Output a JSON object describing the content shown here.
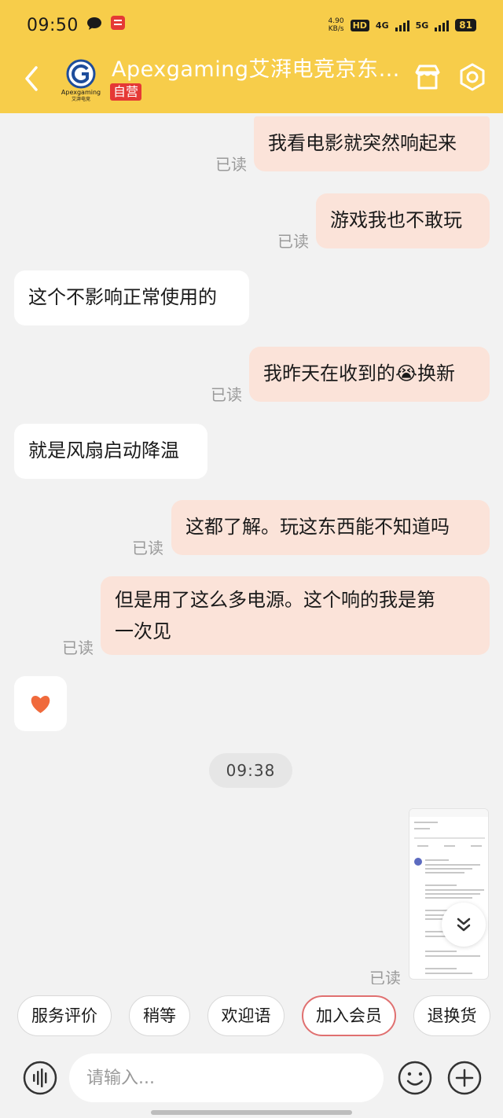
{
  "status_bar": {
    "time": "09:50",
    "net_speed_value": "4.90",
    "net_speed_unit": "KB/s",
    "hd_label": "HD",
    "sig1_label": "4G",
    "sig2_label": "5G",
    "battery": "81"
  },
  "header": {
    "shop_name": "Apexgaming艾湃电竞京东…",
    "self_tag": "自营",
    "logo_text": "Apexgaming",
    "logo_sub": "艾湃电竞"
  },
  "messages": [
    {
      "direction": "out",
      "text": "我看电影就突然响起来",
      "read": "已读"
    },
    {
      "direction": "out",
      "text": "游戏我也不敢玩",
      "read": "已读"
    },
    {
      "direction": "in",
      "text": "这个不影响正常使用的"
    },
    {
      "direction": "out",
      "text_before": "我昨天在收到的",
      "emoji": "😭",
      "text_after": "换新",
      "read": "已读"
    },
    {
      "direction": "in",
      "text": "就是风扇启动降温"
    },
    {
      "direction": "out",
      "text": "这都了解。玩这东西能不知道吗",
      "read": "已读"
    },
    {
      "direction": "out",
      "line1": "但是用了这么多电源。这个响的我是第",
      "line2": "一次见",
      "read": "已读"
    },
    {
      "direction": "in",
      "emoji": "❤"
    }
  ],
  "timestamp": "09:38",
  "image_message": {
    "read": "已读"
  },
  "quick_replies": [
    "服务评价",
    "稍等",
    "欢迎语",
    "加入会员",
    "退换货"
  ],
  "input": {
    "placeholder": "请输入..."
  },
  "colors": {
    "header": "#f7cd4a",
    "outgoing": "#fbe3d9",
    "incoming": "#ffffff",
    "highlight_border": "#e07070"
  },
  "icons": {
    "back": "chevron-left-icon",
    "store": "store-icon",
    "settings": "settings-icon",
    "voice": "voice-icon",
    "emoji": "emoji-icon",
    "plus": "plus-icon",
    "scroll": "scroll-down-icon"
  }
}
